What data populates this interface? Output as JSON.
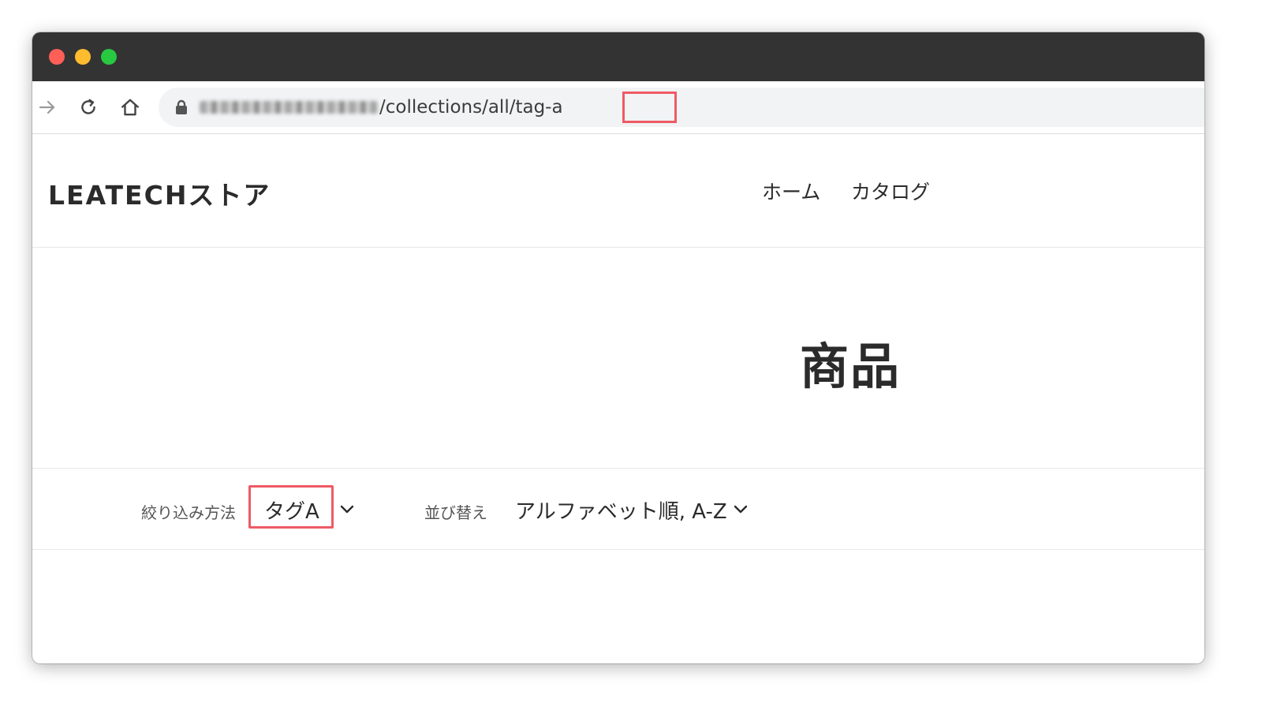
{
  "browser": {
    "url_visible_path": "/collections/all/tag-a",
    "url_highlight": "tag-a",
    "highlight_color": "#ee5a65"
  },
  "site": {
    "logo": "LEATECHストア",
    "nav": {
      "home": "ホーム",
      "catalog": "カタログ"
    }
  },
  "collection": {
    "title": "商品"
  },
  "filter": {
    "label": "絞り込み方法",
    "selected": "タグA"
  },
  "sort": {
    "label": "並び替え",
    "selected": "アルファベット順, A-Z"
  },
  "icons": {
    "forward": "forward-arrow-icon",
    "reload": "reload-icon",
    "home": "home-icon",
    "lock": "lock-icon",
    "chevron": "chevron-down-icon"
  }
}
